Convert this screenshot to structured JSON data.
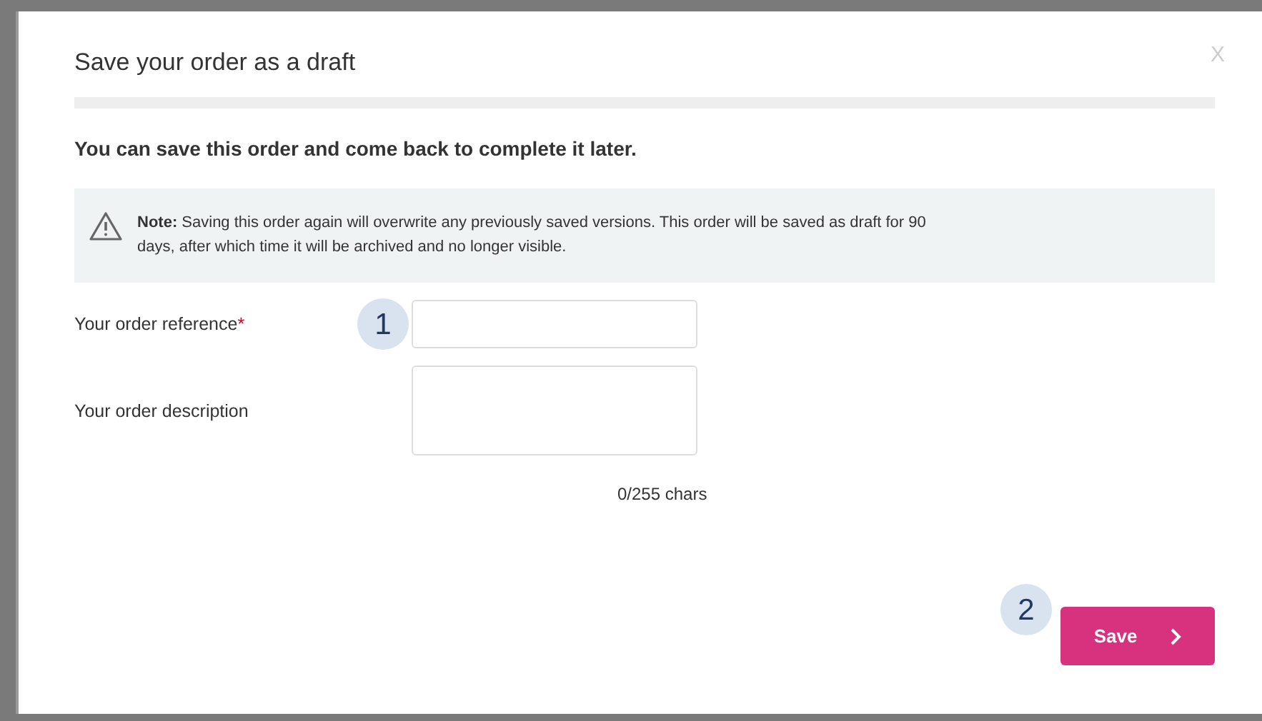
{
  "dialog": {
    "title": "Save your order as a draft",
    "close": "X",
    "intro": "You can save this order and come back to complete it later.",
    "note": "**Note:** Saving this order again will overwrite any previously saved versions. This order will be saved as draft for 90 days, after which time it will be archived and no longer visible.",
    "fields": [
      {
        "kind": "input",
        "label": "Your order reference",
        "required_mark": "*",
        "step": "1"
      },
      {
        "kind": "textarea",
        "label": "Your order description",
        "counter": "0/255 chars"
      }
    ],
    "save": {
      "label": "Save",
      "step": "2"
    }
  }
}
